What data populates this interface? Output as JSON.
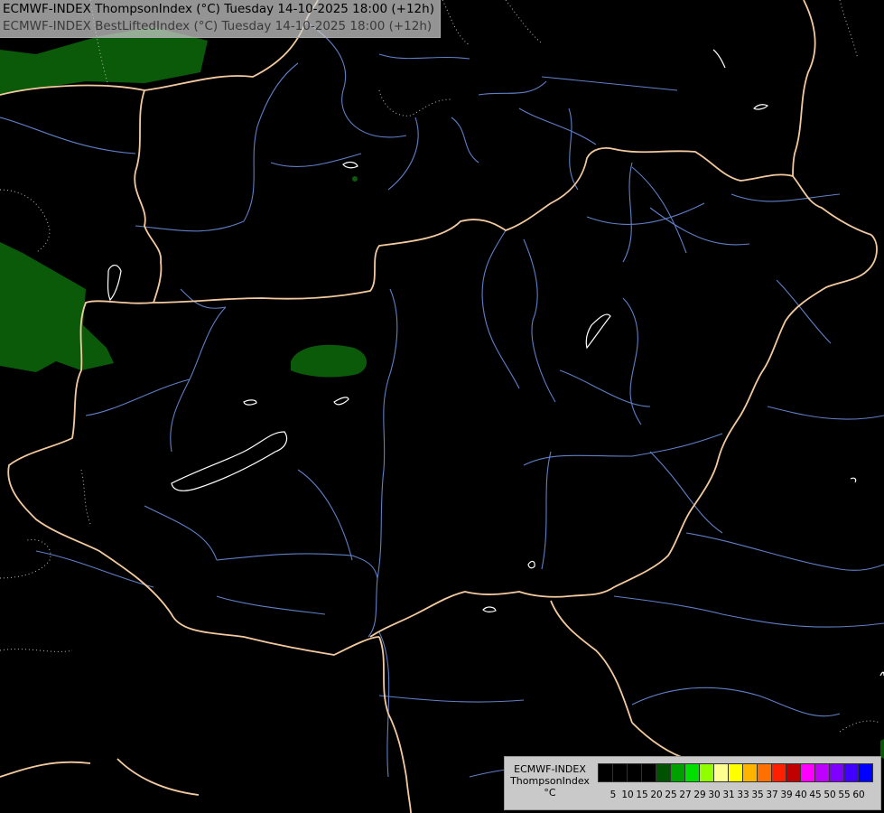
{
  "title": {
    "line1": "ECMWF-INDEX ThompsonIndex (°C) Tuesday 14-10-2025 18:00 (+12h)",
    "line2": "ECMWF-INDEX BestLiftedIndex (°C) Tuesday 14-10-2025 18:00 (+12h)"
  },
  "map": {
    "background_color": "#000000",
    "border_color": "#f3caa0",
    "river_color": "#5f7fc6",
    "contour_color": "#ffffff",
    "field_color": "#0a5a0a"
  },
  "legend": {
    "title_lines": [
      "ECMWF-INDEX",
      "ThompsonIndex",
      "°C"
    ],
    "colors": [
      "#000000",
      "#000000",
      "#000000",
      "#000000",
      "#005200",
      "#00a000",
      "#00e000",
      "#90ff00",
      "#ffff90",
      "#ffff00",
      "#ffb400",
      "#ff7000",
      "#ff2000",
      "#c00000",
      "#ff00ff",
      "#c000ff",
      "#8000ff",
      "#4000ff",
      "#0000ff"
    ],
    "ticks": [
      "5",
      "10",
      "15",
      "20",
      "25",
      "27",
      "29",
      "30",
      "31",
      "33",
      "35",
      "37",
      "39",
      "40",
      "45",
      "50",
      "55",
      "60"
    ]
  }
}
